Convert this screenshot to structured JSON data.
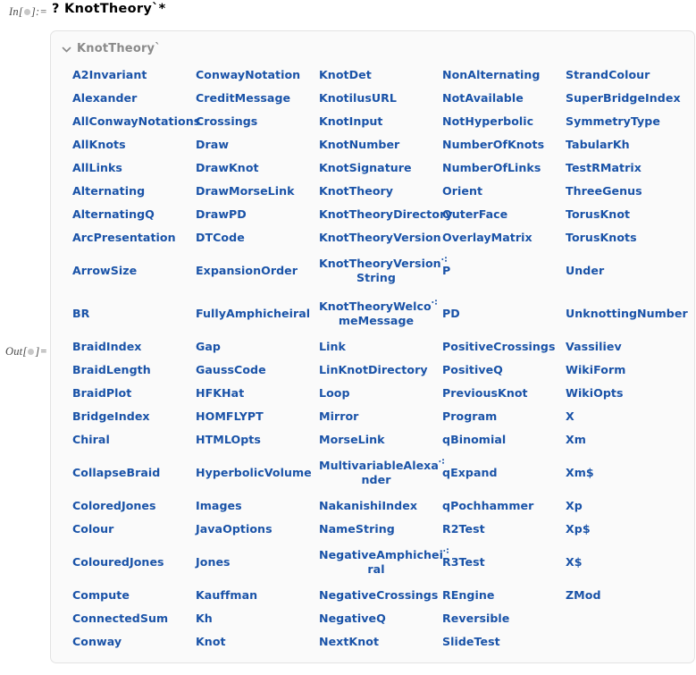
{
  "cell": {
    "in_label_prefix": "In[",
    "in_label_suffix": "]:=",
    "out_label_prefix": "Out[",
    "out_label_suffix": "]=",
    "input_expression": "? KnotTheory`*"
  },
  "panel": {
    "context_name": "KnotTheory`",
    "chevron_icon": "chevron-down-icon",
    "background_color": "#fafafa",
    "border_color": "#e3e3e3",
    "symbol_color": "#1a53a8",
    "context_color": "#8a8a8a"
  },
  "grid": {
    "columns": 5,
    "rows": [
      [
        {
          "text": "A2Invariant"
        },
        {
          "text": "ConwayNotation"
        },
        {
          "text": "KnotDet"
        },
        {
          "text": "NonAlternating"
        },
        {
          "text": "StrandColour"
        }
      ],
      [
        {
          "text": "Alexander"
        },
        {
          "text": "CreditMessage"
        },
        {
          "text": "KnotilusURL"
        },
        {
          "text": "NotAvailable"
        },
        {
          "text": "SuperBridgeIndex"
        }
      ],
      [
        {
          "text": "AllConwayNotations"
        },
        {
          "text": "Crossings"
        },
        {
          "text": "KnotInput"
        },
        {
          "text": "NotHyperbolic"
        },
        {
          "text": "SymmetryType"
        }
      ],
      [
        {
          "text": "AllKnots"
        },
        {
          "text": "Draw"
        },
        {
          "text": "KnotNumber"
        },
        {
          "text": "NumberOfKnots"
        },
        {
          "text": "TabularKh"
        }
      ],
      [
        {
          "text": "AllLinks"
        },
        {
          "text": "DrawKnot"
        },
        {
          "text": "KnotSignature"
        },
        {
          "text": "NumberOfLinks"
        },
        {
          "text": "TestRMatrix"
        }
      ],
      [
        {
          "text": "Alternating"
        },
        {
          "text": "DrawMorseLink"
        },
        {
          "text": "KnotTheory"
        },
        {
          "text": "Orient"
        },
        {
          "text": "ThreeGenus"
        }
      ],
      [
        {
          "text": "AlternatingQ"
        },
        {
          "text": "DrawPD"
        },
        {
          "text": "KnotTheoryDirectory"
        },
        {
          "text": "OuterFace"
        },
        {
          "text": "TorusKnot"
        }
      ],
      [
        {
          "text": "ArcPresentation"
        },
        {
          "text": "DTCode"
        },
        {
          "text": "KnotTheoryVersion"
        },
        {
          "text": "OverlayMatrix"
        },
        {
          "text": "TorusKnots"
        }
      ],
      [
        {
          "text": "ArrowSize"
        },
        {
          "text": "ExpansionOrder"
        },
        {
          "text": "KnotTheoryVersionString",
          "wrap_first": "KnotTheoryVersion",
          "wrap_second": "String"
        },
        {
          "text": "P"
        },
        {
          "text": "Under"
        }
      ],
      [
        {
          "text": "BR"
        },
        {
          "text": "FullyAmphicheiral"
        },
        {
          "text": "KnotTheoryWelcomeMessage",
          "wrap_first": "KnotTheoryWelco",
          "wrap_second": "meMessage"
        },
        {
          "text": "PD"
        },
        {
          "text": "UnknottingNumber"
        }
      ],
      [
        {
          "text": "BraidIndex"
        },
        {
          "text": "Gap"
        },
        {
          "text": "Link"
        },
        {
          "text": "PositiveCrossings"
        },
        {
          "text": "Vassiliev"
        }
      ],
      [
        {
          "text": "BraidLength"
        },
        {
          "text": "GaussCode"
        },
        {
          "text": "LinKnotDirectory"
        },
        {
          "text": "PositiveQ"
        },
        {
          "text": "WikiForm"
        }
      ],
      [
        {
          "text": "BraidPlot"
        },
        {
          "text": "HFKHat"
        },
        {
          "text": "Loop"
        },
        {
          "text": "PreviousKnot"
        },
        {
          "text": "WikiOpts"
        }
      ],
      [
        {
          "text": "BridgeIndex"
        },
        {
          "text": "HOMFLYPT"
        },
        {
          "text": "Mirror"
        },
        {
          "text": "Program"
        },
        {
          "text": "X"
        }
      ],
      [
        {
          "text": "Chiral"
        },
        {
          "text": "HTMLOpts"
        },
        {
          "text": "MorseLink"
        },
        {
          "text": "qBinomial"
        },
        {
          "text": "Xm"
        }
      ],
      [
        {
          "text": "CollapseBraid"
        },
        {
          "text": "HyperbolicVolume"
        },
        {
          "text": "MultivariableAlexander",
          "wrap_first": "MultivariableAlexa",
          "wrap_second": "nder"
        },
        {
          "text": "qExpand"
        },
        {
          "text": "Xm$"
        }
      ],
      [
        {
          "text": "ColoredJones"
        },
        {
          "text": "Images"
        },
        {
          "text": "NakanishiIndex"
        },
        {
          "text": "qPochhammer"
        },
        {
          "text": "Xp"
        }
      ],
      [
        {
          "text": "Colour"
        },
        {
          "text": "JavaOptions"
        },
        {
          "text": "NameString"
        },
        {
          "text": "R2Test"
        },
        {
          "text": "Xp$"
        }
      ],
      [
        {
          "text": "ColouredJones"
        },
        {
          "text": "Jones"
        },
        {
          "text": "NegativeAmphicheiral",
          "wrap_first": "NegativeAmphichei",
          "wrap_second": "ral"
        },
        {
          "text": "R3Test"
        },
        {
          "text": "X$"
        }
      ],
      [
        {
          "text": "Compute"
        },
        {
          "text": "Kauffman"
        },
        {
          "text": "NegativeCrossings"
        },
        {
          "text": "REngine"
        },
        {
          "text": "ZMod"
        }
      ],
      [
        {
          "text": "ConnectedSum"
        },
        {
          "text": "Kh"
        },
        {
          "text": "NegativeQ"
        },
        {
          "text": "Reversible"
        },
        {
          "text": ""
        }
      ],
      [
        {
          "text": "Conway"
        },
        {
          "text": "Knot"
        },
        {
          "text": "NextKnot"
        },
        {
          "text": "SlideTest"
        },
        {
          "text": ""
        }
      ]
    ]
  }
}
